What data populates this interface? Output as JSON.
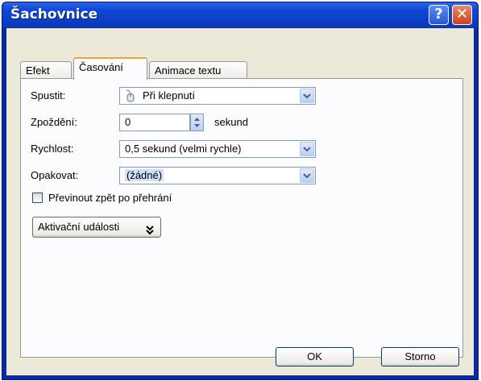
{
  "window": {
    "title": "Šachovnice"
  },
  "titlebar": {
    "help_label": "?",
    "close_label": "✕"
  },
  "tabs": [
    {
      "label": "Efekt",
      "active": false
    },
    {
      "label": "Časování",
      "active": true
    },
    {
      "label": "Animace textu",
      "active": false
    }
  ],
  "timing": {
    "start": {
      "label": "Spustit:",
      "value": "Při klepnutí",
      "icon": "mouse-icon"
    },
    "delay": {
      "label": "Zpoždění:",
      "value": "0",
      "unit": "sekund"
    },
    "speed": {
      "label": "Rychlost:",
      "value": "0,5 sekund (velmi rychle)"
    },
    "repeat": {
      "label": "Opakovat:",
      "value": "(žádné)"
    },
    "rewind": {
      "label": "Převinout zpět po přehrání",
      "checked": false
    },
    "triggers_label": "Aktivační události"
  },
  "footer": {
    "ok_label": "OK",
    "cancel_label": "Storno"
  },
  "colors": {
    "titlebar": "#0b3fc6",
    "client": "#ece9d8",
    "tab_highlight": "#f2a432"
  }
}
